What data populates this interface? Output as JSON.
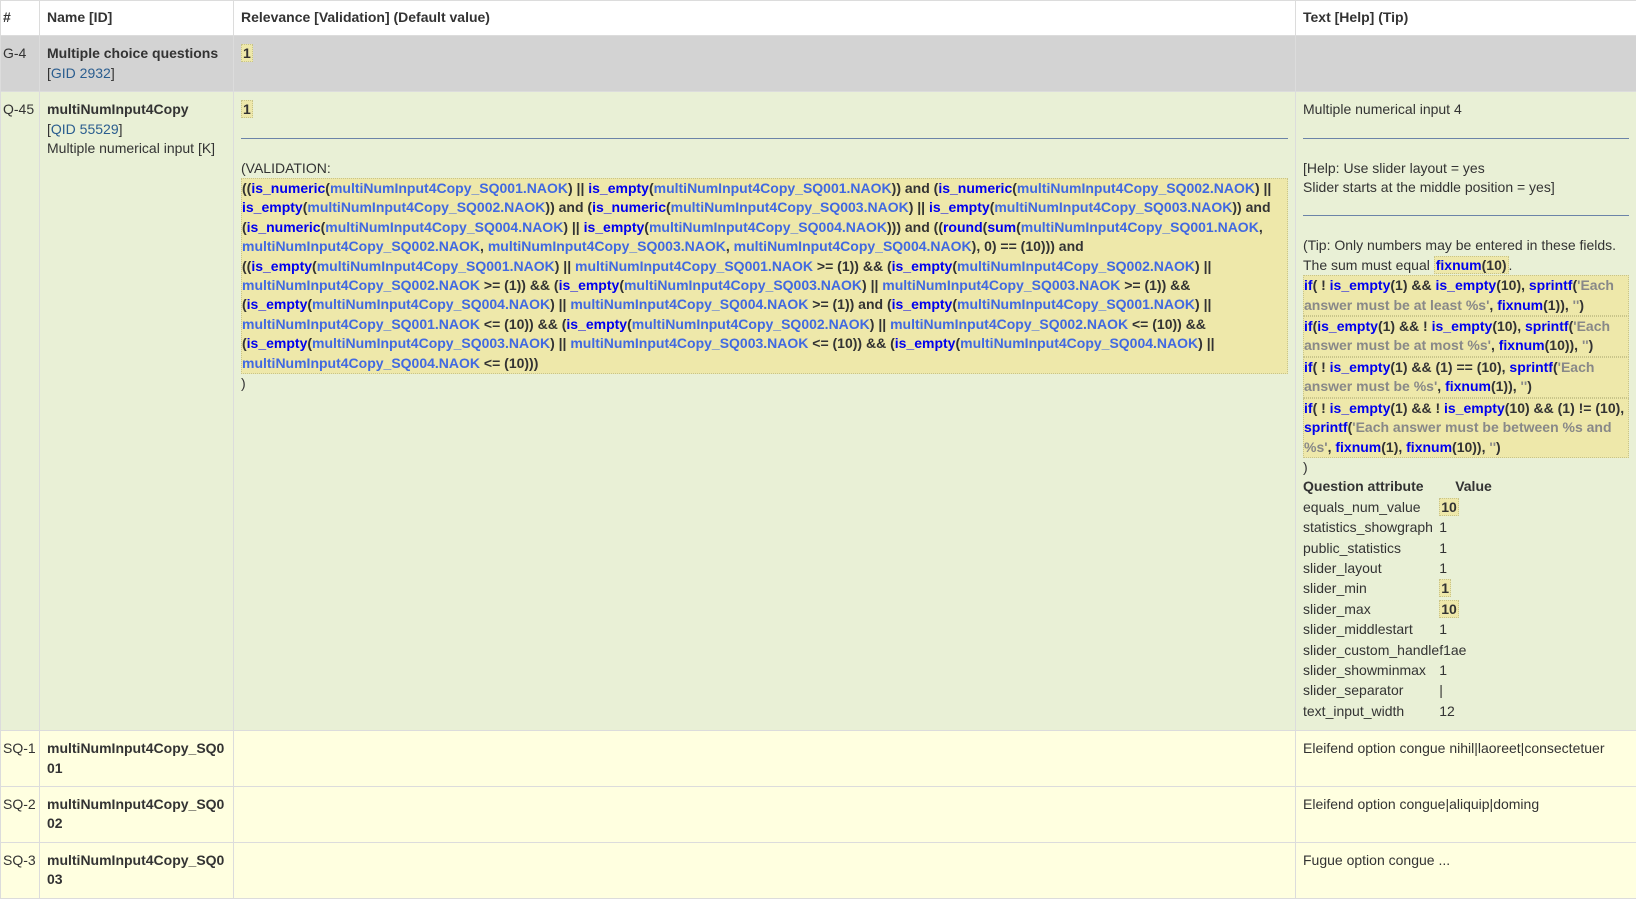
{
  "header": {
    "num": "#",
    "name": "Name [ID]",
    "relevance": "Relevance [Validation] (Default value)",
    "text": "Text [Help] (Tip)"
  },
  "group": {
    "num": "G-4",
    "name": "Multiple choice questions",
    "id_prefix": "[",
    "id": "GID 2932",
    "id_suffix": "]",
    "relevance": "1"
  },
  "question": {
    "num": "Q-45",
    "name": "multiNumInput4Copy",
    "id_prefix": "[",
    "id": "QID 55529",
    "id_suffix": "]",
    "type": "Multiple numerical input [K]",
    "relevance": "1",
    "validation_open": "(VALIDATION:",
    "validation_expr": "((is_numeric(multiNumInput4Copy_SQ001.NAOK) || is_empty(multiNumInput4Copy_SQ001.NAOK)) and (is_numeric(multiNumInput4Copy_SQ002.NAOK) || is_empty(multiNumInput4Copy_SQ002.NAOK)) and (is_numeric(multiNumInput4Copy_SQ003.NAOK) || is_empty(multiNumInput4Copy_SQ003.NAOK)) and (is_numeric(multiNumInput4Copy_SQ004.NAOK) || is_empty(multiNumInput4Copy_SQ004.NAOK))) and ((round(sum(multiNumInput4Copy_SQ001.NAOK, multiNumInput4Copy_SQ002.NAOK, multiNumInput4Copy_SQ003.NAOK, multiNumInput4Copy_SQ004.NAOK), 0) == (10))) and ((is_empty(multiNumInput4Copy_SQ001.NAOK) || multiNumInput4Copy_SQ001.NAOK >= (1)) && (is_empty(multiNumInput4Copy_SQ002.NAOK) || multiNumInput4Copy_SQ002.NAOK >= (1)) && (is_empty(multiNumInput4Copy_SQ003.NAOK) || multiNumInput4Copy_SQ003.NAOK >= (1)) && (is_empty(multiNumInput4Copy_SQ004.NAOK) || multiNumInput4Copy_SQ004.NAOK >= (1)) and (is_empty(multiNumInput4Copy_SQ001.NAOK) || multiNumInput4Copy_SQ001.NAOK <= (10)) && (is_empty(multiNumInput4Copy_SQ002.NAOK) || multiNumInput4Copy_SQ002.NAOK <= (10)) && (is_empty(multiNumInput4Copy_SQ003.NAOK) || multiNumInput4Copy_SQ003.NAOK <= (10)) && (is_empty(multiNumInput4Copy_SQ004.NAOK) || multiNumInput4Copy_SQ004.NAOK <= (10)))",
    "validation_close": ")",
    "text": "Multiple numerical input 4",
    "help_line1": "[Help: Use slider layout = yes",
    "help_line2": "Slider starts at the middle position = yes]",
    "tip_intro": "(Tip: Only numbers may be entered in these fields. The sum must equal ",
    "tip_fixnum": "fixnum(10)",
    "tip_period": ".",
    "tip_lines": [
      "if( ! is_empty(1) && is_empty(10), sprintf('Each answer must be at least %s', fixnum(1)), '')",
      "if(is_empty(1) && ! is_empty(10), sprintf('Each answer must be at most %s', fixnum(10)), '')",
      "if( ! is_empty(1) && (1) == (10), sprintf('Each answer must be %s', fixnum(1)), '')",
      "if( ! is_empty(1) && ! is_empty(10) && (1) != (10), sprintf('Each answer must be between %s and %s', fixnum(1), fixnum(10)), '')"
    ],
    "tip_close": ")",
    "attributes_header": {
      "name": "Question attribute",
      "value": "Value"
    },
    "attributes": [
      {
        "name": "equals_num_value",
        "value": "10",
        "hl": true
      },
      {
        "name": "statistics_showgraph",
        "value": "1"
      },
      {
        "name": "public_statistics",
        "value": "1"
      },
      {
        "name": "slider_layout",
        "value": "1"
      },
      {
        "name": "slider_min",
        "value": "1",
        "hl": true
      },
      {
        "name": "slider_max",
        "value": "10",
        "hl": true
      },
      {
        "name": "slider_middlestart",
        "value": "1"
      },
      {
        "name": "slider_custom_handle",
        "value": "f1ae"
      },
      {
        "name": "slider_showminmax",
        "value": "1"
      },
      {
        "name": "slider_separator",
        "value": "|"
      },
      {
        "name": "text_input_width",
        "value": "12"
      }
    ]
  },
  "subquestions": [
    {
      "num": "SQ-1",
      "name": "multiNumInput4Copy_SQ001",
      "text": "Eleifend option congue nihil|laoreet|consectetuer"
    },
    {
      "num": "SQ-2",
      "name": "multiNumInput4Copy_SQ002",
      "text": "Eleifend option congue|aliquip|doming"
    },
    {
      "num": "SQ-3",
      "name": "multiNumInput4Copy_SQ003",
      "text": "Fugue option congue ..."
    }
  ]
}
